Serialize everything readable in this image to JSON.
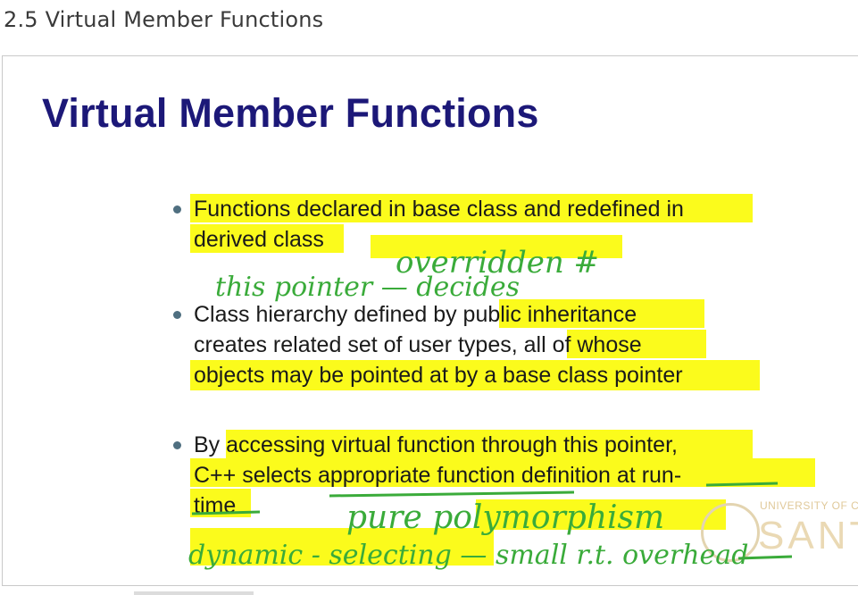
{
  "page": {
    "heading": "2.5 Virtual Member Functions"
  },
  "slide": {
    "title": "Virtual Member Functions",
    "bullets": [
      {
        "lines": [
          "Functions declared in base class and redefined in",
          "derived class"
        ]
      },
      {
        "lines": [
          "Class hierarchy defined by public inheritance",
          "creates related set of user types, all of whose",
          "objects may be pointed at by a base class pointer"
        ]
      },
      {
        "lines": [
          "By accessing virtual function through this pointer,",
          "C++ selects appropriate function definition at run-",
          "time"
        ]
      }
    ],
    "annotations": {
      "overridden": "overridden #",
      "this_pointer": "this pointer — decides",
      "pure_polymorphism": "pure polymorphism",
      "dynamic_selecting": "dynamic - selecting — small r.t. overhead"
    },
    "seal": {
      "university": "UNIVERSITY OF CA",
      "name": "SANTA C"
    }
  },
  "colors": {
    "title": "#1c1878",
    "highlight": "#fbfb1c",
    "ink": "#3aab3a"
  }
}
